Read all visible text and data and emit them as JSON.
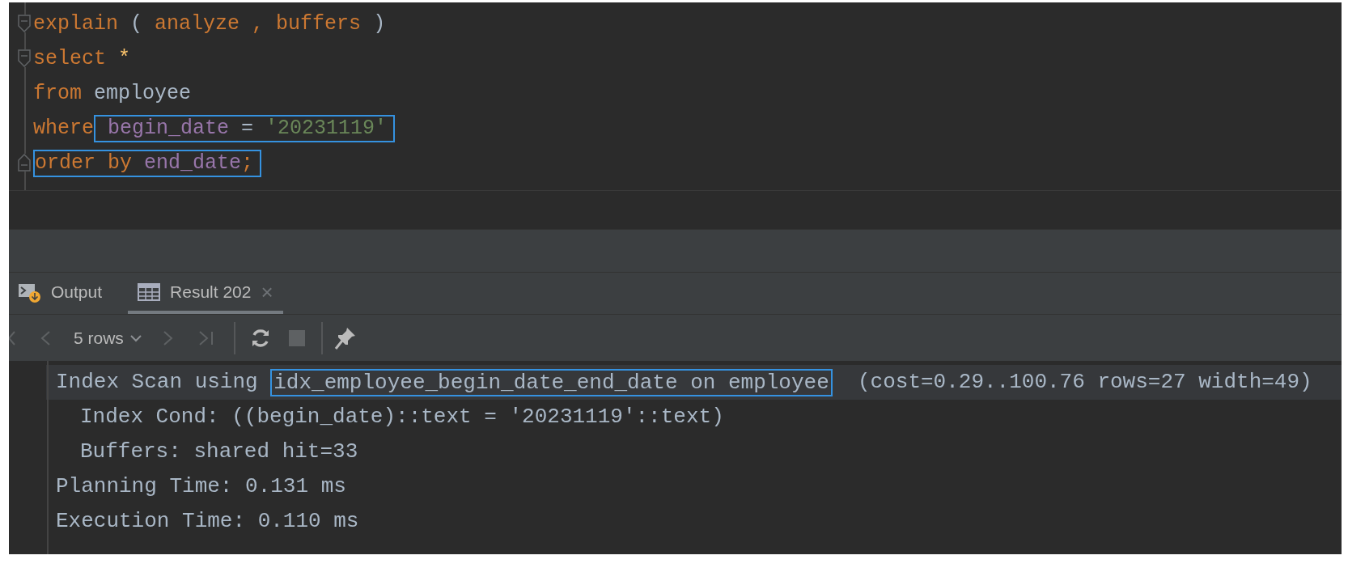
{
  "editor": {
    "lines": [
      {
        "kind": "fold_open",
        "segments": [
          {
            "boxed": false,
            "tokens": [
              {
                "kind": "keyword",
                "text": "explain"
              },
              {
                "kind": "punct",
                "text": " ( "
              },
              {
                "kind": "keyword",
                "text": "analyze"
              },
              {
                "kind": "keyword",
                "text": " , "
              },
              {
                "kind": "keyword",
                "text": "buffers"
              },
              {
                "kind": "punct",
                "text": " )"
              }
            ]
          }
        ]
      },
      {
        "kind": "fold_open",
        "segments": [
          {
            "boxed": false,
            "tokens": [
              {
                "kind": "keyword",
                "text": "select "
              },
              {
                "kind": "star",
                "text": "*"
              }
            ]
          }
        ]
      },
      {
        "kind": "plain",
        "segments": [
          {
            "boxed": false,
            "tokens": [
              {
                "kind": "keyword",
                "text": "from "
              },
              {
                "kind": "identifier",
                "text": "employee"
              }
            ]
          }
        ]
      },
      {
        "kind": "plain",
        "segments": [
          {
            "boxed": false,
            "tokens": [
              {
                "kind": "keyword",
                "text": "where"
              }
            ]
          },
          {
            "boxed": true,
            "tokens": [
              {
                "kind": "column",
                "text": " begin_date"
              },
              {
                "kind": "punct",
                "text": " = "
              },
              {
                "kind": "string",
                "text": "'20231119'"
              }
            ]
          }
        ]
      },
      {
        "kind": "fold_close",
        "segments": [
          {
            "boxed": true,
            "tokens": [
              {
                "kind": "keyword",
                "text": "order by "
              },
              {
                "kind": "column",
                "text": "end_date"
              },
              {
                "kind": "keyword",
                "text": ";"
              }
            ]
          }
        ]
      }
    ]
  },
  "tabs": [
    {
      "kind": "output",
      "label": "Output",
      "selected": false,
      "closable": false
    },
    {
      "kind": "result",
      "label": "Result 202",
      "selected": true,
      "closable": true,
      "close": "×"
    }
  ],
  "toolbar": {
    "rows": "5 rows",
    "first_disabled": true,
    "prev_disabled": true,
    "next_disabled": true,
    "last_disabled": true,
    "stop_disabled": true
  },
  "results": [
    {
      "selected": true,
      "segments": [
        {
          "boxed": false,
          "text": "Index Scan using "
        },
        {
          "boxed": true,
          "text": "idx_employee_begin_date_end_date on employee"
        },
        {
          "boxed": false,
          "text": "  (cost=0.29..100.76 rows=27 width=49)"
        }
      ],
      "children": [
        {
          "selected": false,
          "segments": [
            {
              "boxed": false,
              "text": "Index Cond: ((begin_date)::text = '20231119'::text)"
            }
          ]
        },
        {
          "selected": false,
          "segments": [
            {
              "boxed": false,
              "text": "Buffers: shared hit=33"
            }
          ]
        }
      ]
    },
    {
      "selected": false,
      "segments": [
        {
          "boxed": false,
          "text": "Planning Time: 0.131 ms"
        }
      ]
    },
    {
      "selected": false,
      "segments": [
        {
          "boxed": false,
          "text": "Execution Time: 0.110 ms"
        }
      ]
    }
  ]
}
